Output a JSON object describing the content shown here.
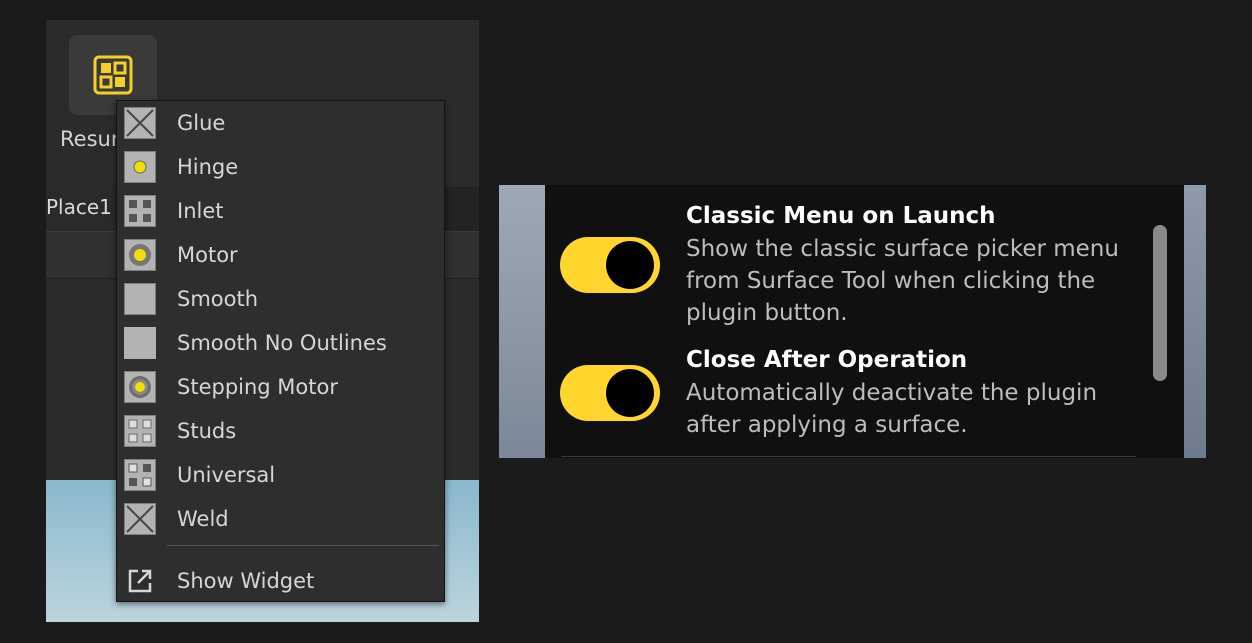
{
  "studio": {
    "plugin_button_label": "Resur",
    "tab_label": "Place1"
  },
  "menu": {
    "items": [
      {
        "label": "Glue",
        "icon": "glue-icon"
      },
      {
        "label": "Hinge",
        "icon": "hinge-icon"
      },
      {
        "label": "Inlet",
        "icon": "inlet-icon"
      },
      {
        "label": "Motor",
        "icon": "motor-icon"
      },
      {
        "label": "Smooth",
        "icon": "smooth-icon"
      },
      {
        "label": "Smooth No Outlines",
        "icon": "smooth-no-outlines-icon"
      },
      {
        "label": "Stepping Motor",
        "icon": "stepping-motor-icon"
      },
      {
        "label": "Studs",
        "icon": "studs-icon"
      },
      {
        "label": "Universal",
        "icon": "universal-icon"
      },
      {
        "label": "Weld",
        "icon": "weld-icon"
      }
    ],
    "show_widget_label": "Show Widget"
  },
  "settings": {
    "classic_menu": {
      "title": "Classic Menu on Launch",
      "description": "Show the classic surface picker menu from Surface Tool when clicking the plugin button.",
      "enabled": true
    },
    "close_after": {
      "title": "Close After Operation",
      "description": "Automatically deactivate the plugin after applying a surface.",
      "enabled": true
    }
  },
  "colors": {
    "accent": "#ffd52e",
    "panel_bg": "#2e2e2e",
    "settings_bg": "#101010"
  }
}
